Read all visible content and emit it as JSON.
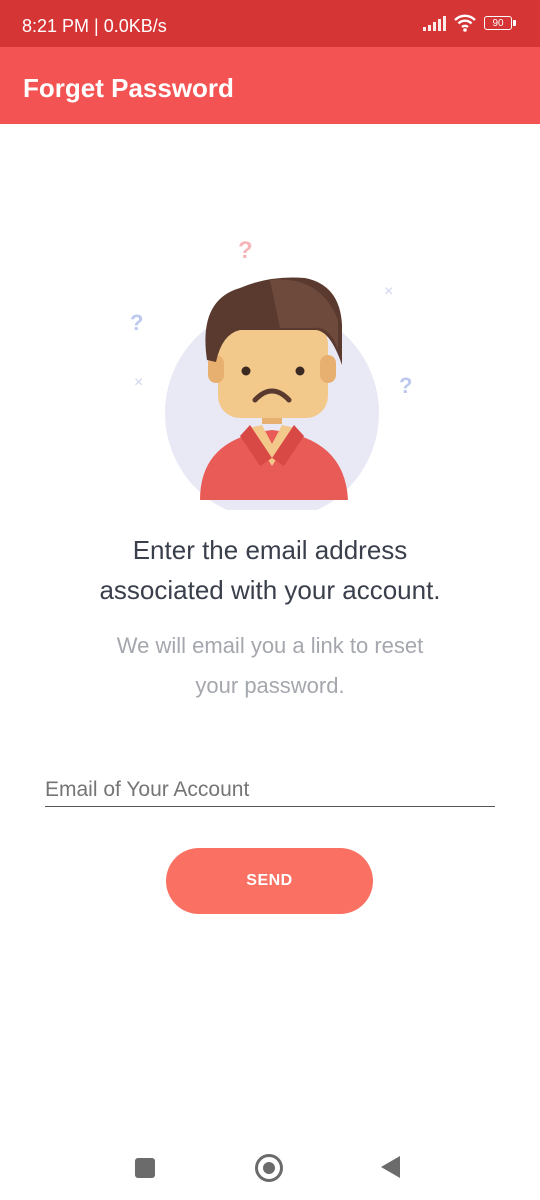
{
  "status_bar": {
    "time_network": "8:21 PM | 0.0KB/s",
    "battery": "90",
    "signal_icon": "signal-icon",
    "wifi_icon": "wifi-icon"
  },
  "app_bar": {
    "title": "Forget Password"
  },
  "content": {
    "illustration_icon": "confused-person-illustration",
    "heading_line1": "Enter the email address",
    "heading_line2": "associated with your account.",
    "subtext_line1": "We will email you a link to reset",
    "subtext_line2": "your password."
  },
  "form": {
    "email_placeholder": "Email of Your Account",
    "email_value": "",
    "send_label": "SEND"
  },
  "nav_bar": {
    "recents_icon": "square-icon",
    "home_icon": "circle-icon",
    "back_icon": "triangle-back-icon"
  },
  "colors": {
    "status_bar": "#d63535",
    "app_bar": "#f45353",
    "button": "#fa7163"
  }
}
